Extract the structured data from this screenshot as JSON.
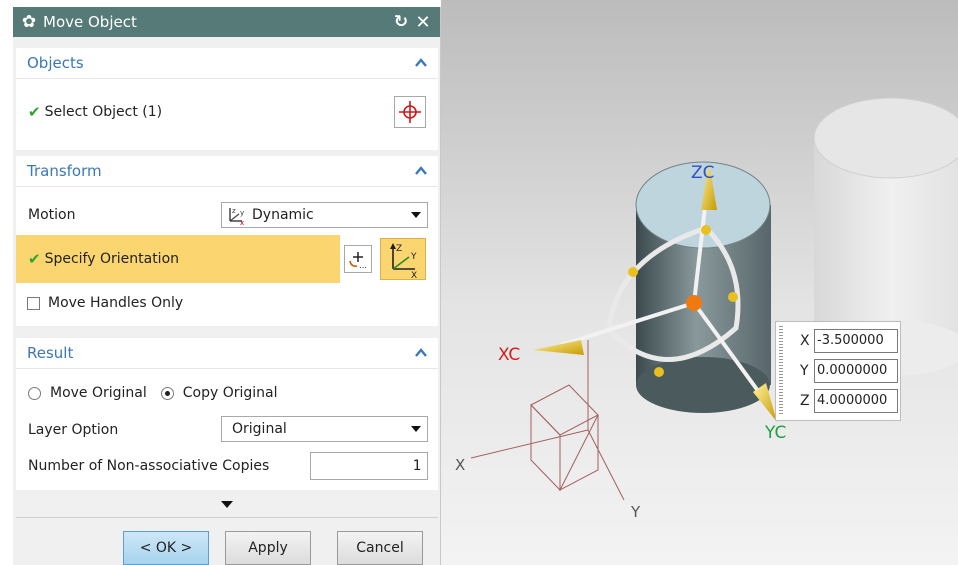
{
  "dialog": {
    "title": "Move Object"
  },
  "objects": {
    "header": "Objects",
    "select_label": "Select Object (1)"
  },
  "transform": {
    "header": "Transform",
    "motion_label": "Motion",
    "motion_value": "Dynamic",
    "specify_orientation": "Specify Orientation",
    "move_handles_only": "Move Handles Only"
  },
  "result": {
    "header": "Result",
    "move_original": "Move Original",
    "copy_original": "Copy Original",
    "selected_option": "Copy Original",
    "layer_option_label": "Layer Option",
    "layer_option_value": "Original",
    "copies_label": "Number of Non-associative Copies",
    "copies_value": "1"
  },
  "buttons": {
    "ok": "< OK >",
    "apply": "Apply",
    "cancel": "Cancel"
  },
  "viewport": {
    "zc_label": "ZC",
    "xc_label": "XC",
    "yc_label": "YC",
    "x_label": "X",
    "y_label": "Y",
    "colors": {
      "zc": "#2f4fc8",
      "xc": "#d02020",
      "yc": "#20a040",
      "handle_arrow": "#e8c020",
      "highlight": "#fad570"
    },
    "coord_box": {
      "x_label": "X",
      "x_value": "-3.500000",
      "y_label": "Y",
      "y_value": "0.0000000",
      "z_label": "Z",
      "z_value": "4.0000000"
    }
  }
}
